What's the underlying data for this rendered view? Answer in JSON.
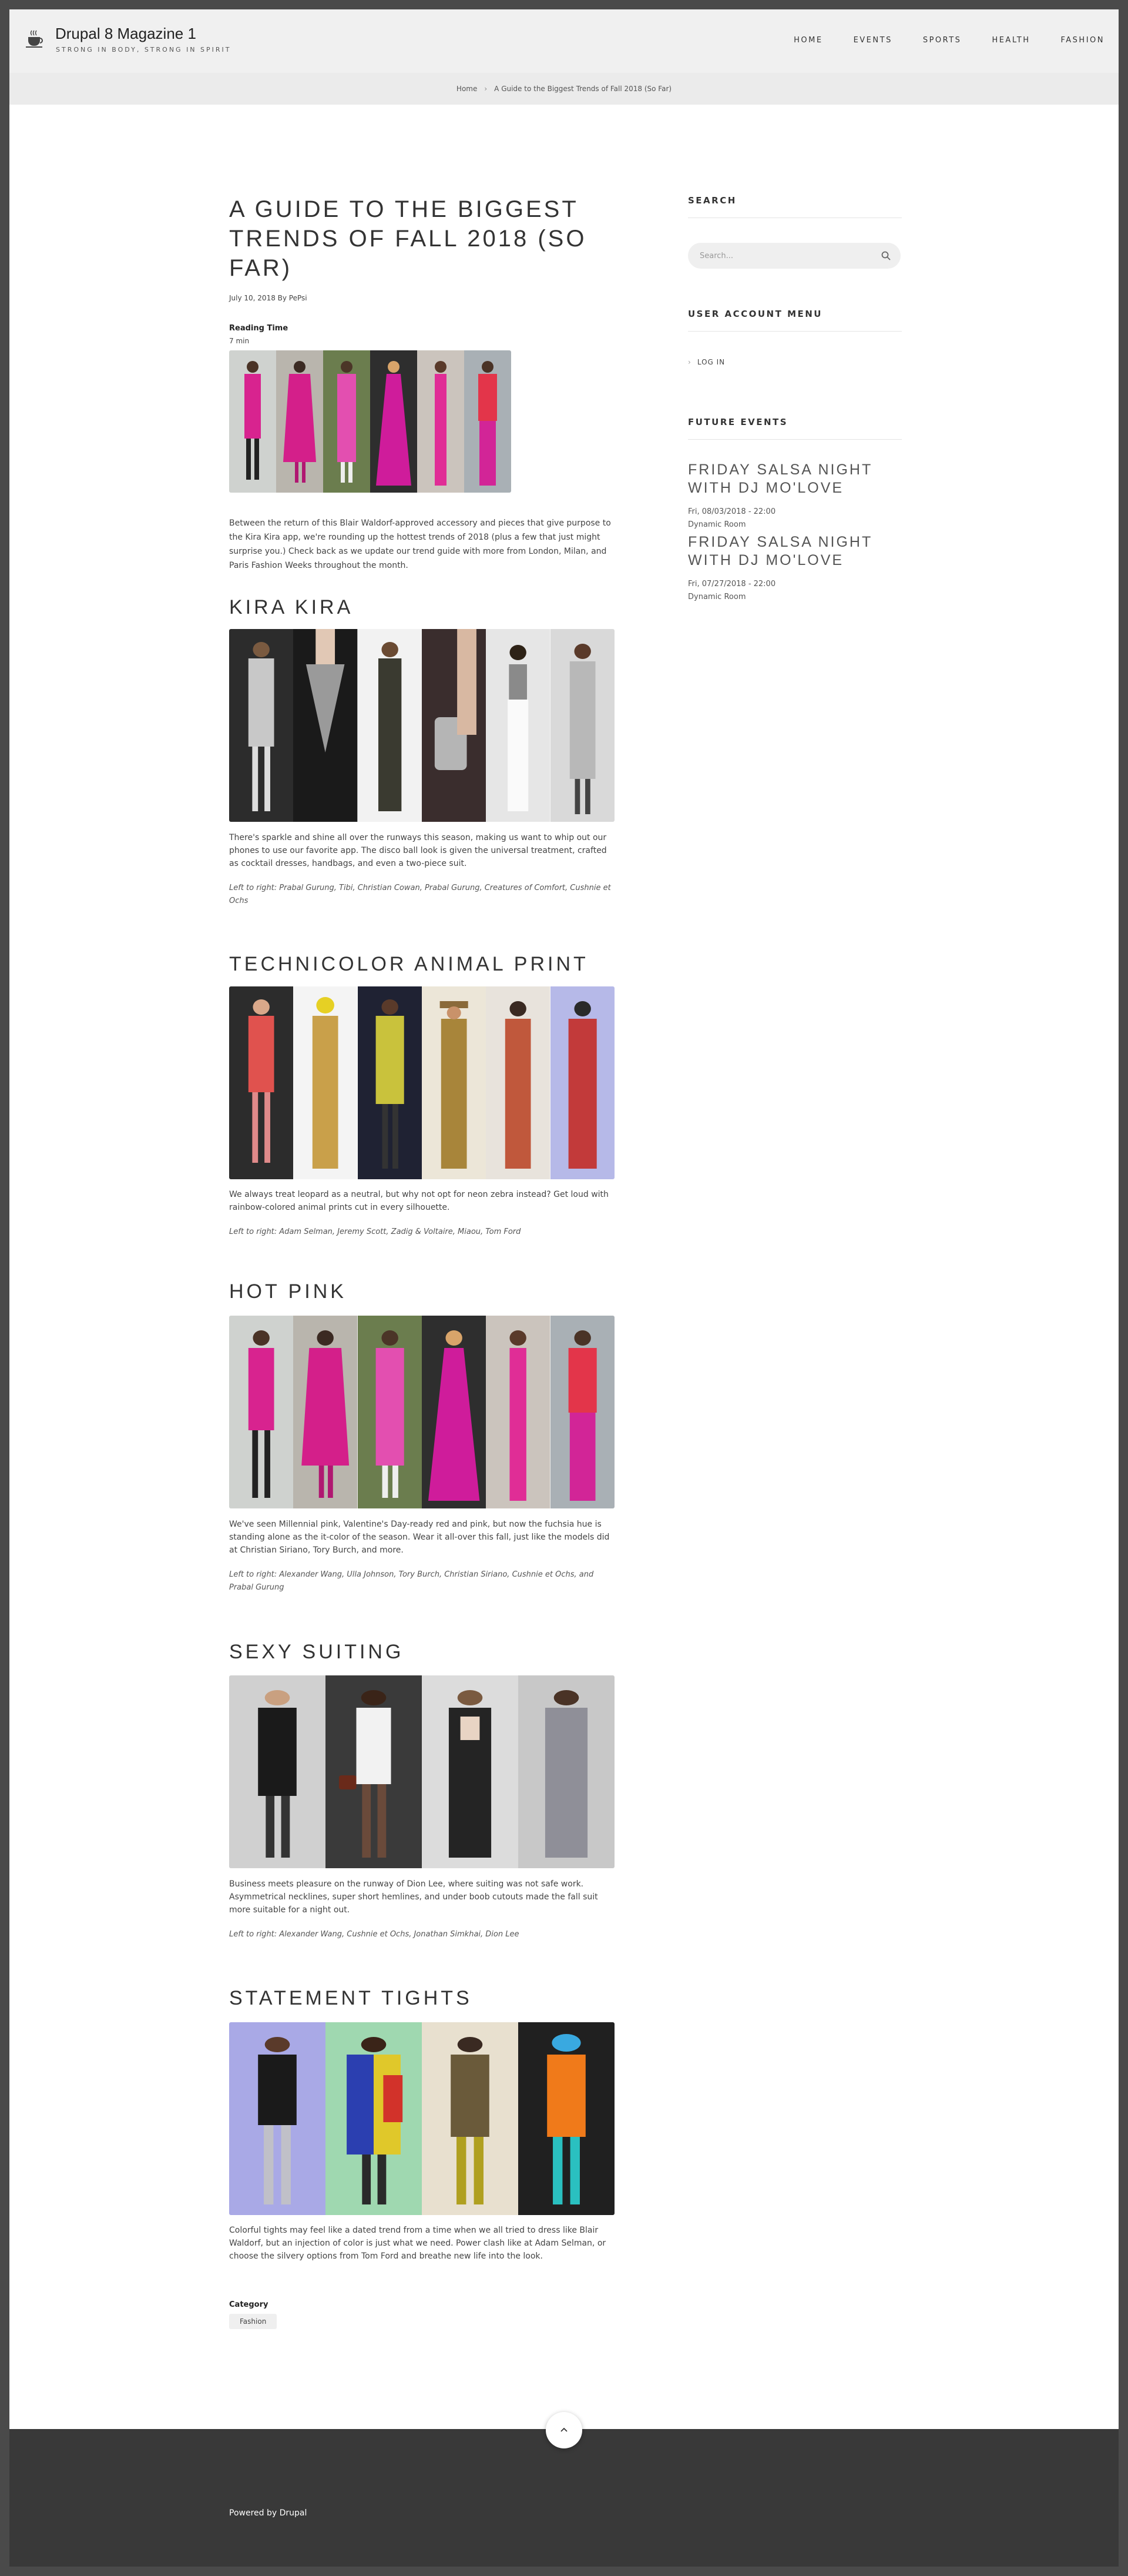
{
  "site": {
    "name": "Drupal 8 Magazine 1",
    "slogan": "STRONG IN BODY, STRONG IN SPIRIT",
    "icon": "coffee-cup-icon"
  },
  "nav": {
    "items": [
      "HOME",
      "EVENTS",
      "SPORTS",
      "HEALTH",
      "FASHION"
    ]
  },
  "breadcrumb": {
    "home": "Home",
    "separator": "›",
    "current": "A Guide to the Biggest Trends of Fall 2018 (So Far)"
  },
  "article": {
    "title": "A GUIDE TO THE BIGGEST TRENDS OF FALL 2018 (SO FAR)",
    "meta": "July 10, 2018 By PePsi",
    "reading_time_label": "Reading Time",
    "reading_time_value": "7 min",
    "intro": "Between the return of this Blair Waldorf-approved accessory and pieces that give purpose to the Kira Kira app, we're rounding up the hottest trends of 2018 (plus a few that just might surprise you.) Check back as we update our trend guide with more from London, Milan, and Paris Fashion Weeks throughout the month.",
    "sections": [
      {
        "heading": "KIRA KIRA",
        "text": "There's sparkle and shine all over the runways this season, making us want to whip out our phones to use our favorite app. The disco ball look is given the universal treatment, crafted as cocktail dresses, handbags, and even a two-piece suit.",
        "caption": "Left to right: Prabal Gurung, Tibi, Christian Cowan, Prabal Gurung, Creatures of Comfort, Cushnie et Ochs"
      },
      {
        "heading": "TECHNICOLOR ANIMAL PRINT",
        "text": "We always treat leopard as a neutral, but why not opt for neon zebra instead? Get loud with rainbow-colored animal prints cut in every silhouette.",
        "caption": "Left to right: Adam Selman, Jeremy Scott, Zadig & Voltaire, Miaou, Tom Ford"
      },
      {
        "heading": "HOT PINK",
        "text": "We've seen Millennial pink, Valentine's Day-ready red and pink, but now the fuchsia hue is standing alone as the it-color of the season. Wear it all-over this fall, just like the models did at Christian Siriano, Tory Burch, and more.",
        "caption": "Left to right: Alexander Wang, Ulla Johnson, Tory Burch, Christian Siriano, Cushnie et Ochs, and Prabal Gurung"
      },
      {
        "heading": "SEXY SUITING",
        "text": "Business meets pleasure on the runway of Dion Lee, where suiting was not safe work. Asymmetrical necklines, super short hemlines, and under boob cutouts made the fall suit more suitable for a night out.",
        "caption": "Left to right: Alexander Wang, Cushnie et Ochs, Jonathan Simkhai, Dion Lee"
      },
      {
        "heading": "STATEMENT TIGHTS",
        "text": "Colorful tights may feel like a dated trend from a time when we all tried to dress like Blair Waldorf, but an injection of color is just what we need. Power clash like at Adam Selman, or choose the silvery options from Tom Ford and breathe new life into the look.",
        "caption": ""
      }
    ],
    "category_label": "Category",
    "category_value": "Fashion"
  },
  "sidebar": {
    "search_heading": "SEARCH",
    "search_placeholder": "Search...",
    "account_heading": "USER ACCOUNT MENU",
    "login_label": "LOG IN",
    "events_heading": "FUTURE EVENTS",
    "events": [
      {
        "title": "FRIDAY SALSA NIGHT WITH DJ MO'LOVE",
        "date": "Fri, 08/03/2018 - 22:00",
        "room": "Dynamic Room"
      },
      {
        "title": "FRIDAY SALSA NIGHT WITH DJ MO'LOVE",
        "date": "Fri, 07/27/2018 - 22:00",
        "room": "Dynamic Room"
      }
    ]
  },
  "footer": {
    "powered_by": "Powered by Drupal"
  },
  "colors": {
    "page_background": "#4a4a4a",
    "header_background": "#f0f0f0",
    "footer_background": "#393939",
    "hot_pink": "#e0209a"
  }
}
